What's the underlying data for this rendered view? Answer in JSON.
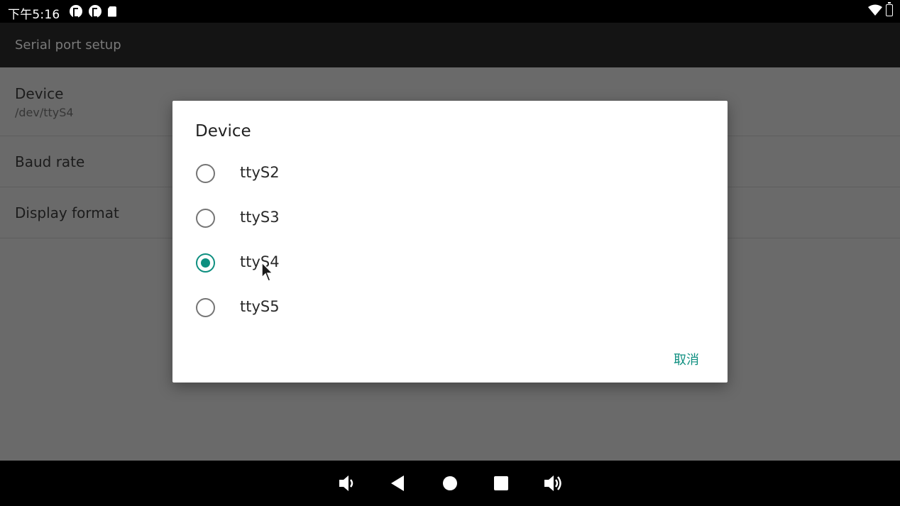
{
  "status_bar": {
    "time": "下午5:16",
    "left_icons": [
      "p-circle-icon",
      "p-circle-icon",
      "sd-card-icon"
    ],
    "right_icons": [
      "wifi-icon",
      "battery-icon"
    ]
  },
  "app_bar": {
    "title": "Serial port setup"
  },
  "preferences": [
    {
      "title": "Device",
      "summary": "/dev/ttyS4"
    },
    {
      "title": "Baud rate",
      "summary": ""
    },
    {
      "title": "Display format",
      "summary": ""
    }
  ],
  "dialog": {
    "title": "Device",
    "options": [
      {
        "label": "ttyS2",
        "checked": false
      },
      {
        "label": "ttyS3",
        "checked": false
      },
      {
        "label": "ttyS4",
        "checked": true
      },
      {
        "label": "ttyS5",
        "checked": false
      }
    ],
    "cancel_label": "取消"
  },
  "nav_bar": {
    "icons": [
      "volume-down-icon",
      "back-icon",
      "home-icon",
      "recents-icon",
      "volume-up-icon"
    ]
  },
  "colors": {
    "accent": "#0e8f80",
    "scrim": "#6a6a6a",
    "appbar": "#141414"
  }
}
